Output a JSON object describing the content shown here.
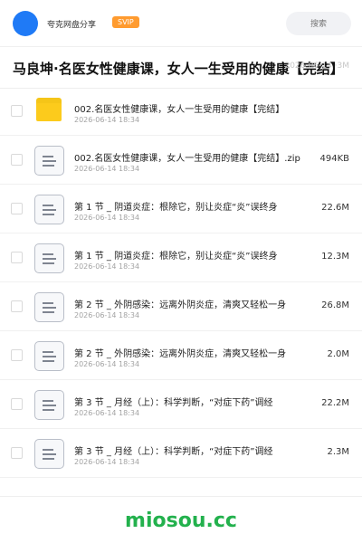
{
  "header": {
    "brand": "夸克网盘分享",
    "badge": "SVIP",
    "search_placeholder": "搜索"
  },
  "title": {
    "text": "马良坤·名医女性健康课，女人一生受用的健康【完结】",
    "meta": "2026-06-14 ·3M"
  },
  "files": [
    {
      "name": "002.名医女性健康课，女人一生受用的健康【完结】",
      "date": "2026-06-14 18:34",
      "size": "",
      "icon": "folder-icon"
    },
    {
      "name": "002.名医女性健康课，女人一生受用的健康【完结】.zip",
      "date": "2026-06-14 18:34",
      "size": "494KB",
      "icon": "document-icon"
    },
    {
      "name": "第 1 节 _ 阴道炎症：根除它，别让炎症“炎”误终身",
      "date": "2026-06-14 18:34",
      "size": "22.6M",
      "icon": "document-icon"
    },
    {
      "name": "第 1 节 _ 阴道炎症：根除它，别让炎症“炎”误终身",
      "date": "2026-06-14 18:34",
      "size": "12.3M",
      "icon": "document-icon"
    },
    {
      "name": "第 2 节 _ 外阴感染：远离外阴炎症，清爽又轻松一身",
      "date": "2026-06-14 18:34",
      "size": "26.8M",
      "icon": "document-icon"
    },
    {
      "name": "第 2 节 _ 外阴感染：远离外阴炎症，清爽又轻松一身",
      "date": "2026-06-14 18:34",
      "size": "2.0M",
      "icon": "document-icon"
    },
    {
      "name": "第 3 节 _ 月经（上）：科学判断，“对症下药”调经",
      "date": "2026-06-14 18:34",
      "size": "22.2M",
      "icon": "document-icon"
    },
    {
      "name": "第 3 节 _ 月经（上）：科学判断，“对症下药”调经",
      "date": "2026-06-14 18:34",
      "size": "2.3M",
      "icon": "document-icon"
    }
  ],
  "footer": {
    "watermark": "miosou.cc"
  }
}
